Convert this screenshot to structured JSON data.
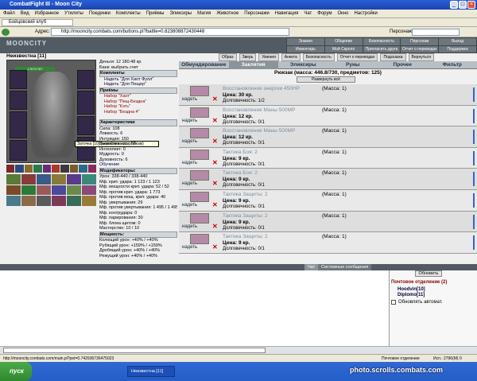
{
  "window": {
    "title": "CombatFight III - Moon City"
  },
  "menu": [
    "Файл",
    "Вид",
    "Избранное",
    "Утилиты",
    "Поединки",
    "Комплекты",
    "Приёмы",
    "Эликсиры",
    "Магия",
    "Животное",
    "Персонажи",
    "Навигация",
    "Чат",
    "Форум",
    "Окно",
    "Настройки"
  ],
  "tab": {
    "label": "Бойцовский клуб"
  },
  "address": {
    "label": "Адрес:",
    "url": "http://mooncity.combats.com/buttons.pl?battle=0.823808872430448",
    "search_label": "Персонаж:"
  },
  "site": {
    "logo": "MOONCITY"
  },
  "topnav": [
    "Знания",
    "Общение",
    "Безопасность",
    "Персонаж",
    "Выход",
    "Инвентарь",
    "Мой Скролл",
    "Пригласить друга",
    "Отчет о переводах",
    "Поддержка"
  ],
  "subnav": [
    "Образ",
    "Зверь",
    "Умения",
    "Анкета",
    "Безопасность",
    "Отчет о переводах",
    "Подсказка",
    "Вернуться"
  ],
  "categories": [
    {
      "label": "Обмундирование",
      "active": false
    },
    {
      "label": "Заклятия",
      "active": true
    },
    {
      "label": "Эликсиры",
      "active": false
    },
    {
      "label": "Руны",
      "active": false
    },
    {
      "label": "Прочее",
      "active": false
    },
    {
      "label": "Фильтр",
      "active": false
    }
  ],
  "bag": {
    "text": "Рюкзак (масса: 446.8/730, предметов: 125)",
    "expand": "Развернуть всё"
  },
  "character": {
    "name": "Неизвестна [11]",
    "hp": "1767/1767"
  },
  "stats": {
    "money": "Деньги: 12 180.48 кр.",
    "bank": "Банк: выбрать счет",
    "kit_header": "Комплекты",
    "kit_items": [
      "Надеть \"Для Хаот Фулл\"",
      "Надеть \"Для Пещер\""
    ],
    "tricks_header": "Приёмы",
    "tricks": [
      "Набор \"Хаот\"",
      "Набор \"Пещ-Бездна\"",
      "Набор \"Кэть\"",
      "Набор \"Бездна 4\""
    ],
    "tooltip": "Заточка [10] (перейти к настройкам)",
    "chars_header": "Характеристики",
    "chars": [
      "Сила: 108",
      "Ловкость: 6",
      "Интуиция: 150",
      "Выносливость: 50",
      "Интеллект: 0",
      "Мудрость: 0",
      "Духовность: 6"
    ],
    "train": "Обучение",
    "mods_header": "Модификаторы:",
    "mods": [
      "Урон: 338-440 / 338-440",
      "Мф. крит. удара: 1 123 / 1 123",
      "Мф. мощности крит. удара: 52 / 52",
      "Мф. против крит. удара: 1 773",
      "Мф. против мощ. крит. удара: 40",
      "Мф. увертывания: 29",
      "Мф. против увертывания: 1 495 / 1 495",
      "Мф. контрудара: 0",
      "Мф. парирования: 30",
      "Мф. блока щитом: 0",
      "Мастерство: 10 / 10"
    ],
    "power_header": "Мощность:",
    "power": [
      "Колющий урон: +40% / +40%",
      "Рубящий урон: +159% / +159%",
      "Дробящий урон: +40% / +40%",
      "Режущий урон: +40% / +40%"
    ]
  },
  "items": [
    {
      "name": "Восстановление энергии 450HP",
      "mass": "(Масса: 1)",
      "price": "Цена: 30 кр.",
      "dur": "Долговечность: 1/2",
      "don": "надеть"
    },
    {
      "name": "Восстановление Маны 500MP",
      "mass": "(Масса: 1)",
      "price": "Цена: 12 кр.",
      "dur": "Долговечность: 0/1",
      "don": "надеть"
    },
    {
      "name": "Восстановление Маны 500MP",
      "mass": "(Масса: 1)",
      "price": "Цена: 12 кр.",
      "dur": "Долговечность: 0/1",
      "don": "надеть"
    },
    {
      "name": "Тактика Боя: 2",
      "mass": "(Масса: 1)",
      "price": "Цена: 9 кр.",
      "dur": "Долговечность: 0/1",
      "don": "надеть"
    },
    {
      "name": "Тактика Боя: 2",
      "mass": "(Масса: 1)",
      "price": "Цена: 9 кр.",
      "dur": "Долговечность: 0/1",
      "don": "надеть"
    },
    {
      "name": "Тактика Защиты: 2",
      "mass": "(Масса: 1)",
      "price": "Цена: 9 кр.",
      "dur": "Долговечность: 0/1",
      "don": "надеть"
    },
    {
      "name": "Тактика Защиты: 2",
      "mass": "(Масса: 1)",
      "price": "Цена: 9 кр.",
      "dur": "Долговечность: 0/1",
      "don": "надеть"
    },
    {
      "name": "Тактика Защиты: 2",
      "mass": "(Масса: 1)",
      "price": "Цена: 9 кр.",
      "dur": "Долговечность: 0/1",
      "don": "надеть"
    }
  ],
  "chat": {
    "tab_chat": "Чат",
    "tab_sys": "Системные сообщения"
  },
  "right": {
    "refresh": "Обновить",
    "post": "Почтовое отделение (2)",
    "users": [
      "Hoodvin[10]",
      "Diplomo[11]"
    ],
    "autoupdate": "Обновлять автомат."
  },
  "status": {
    "url": "http://mooncity.combats.com/main.pl?pet=0.742936736475023",
    "right": "Почтовое отделение",
    "mem": "Исп.: 2796(М) 0"
  },
  "taskbar": {
    "start": "пуск",
    "item": "Неизвестна [11]"
  },
  "watermark": "photo.scrolls.combats.com"
}
